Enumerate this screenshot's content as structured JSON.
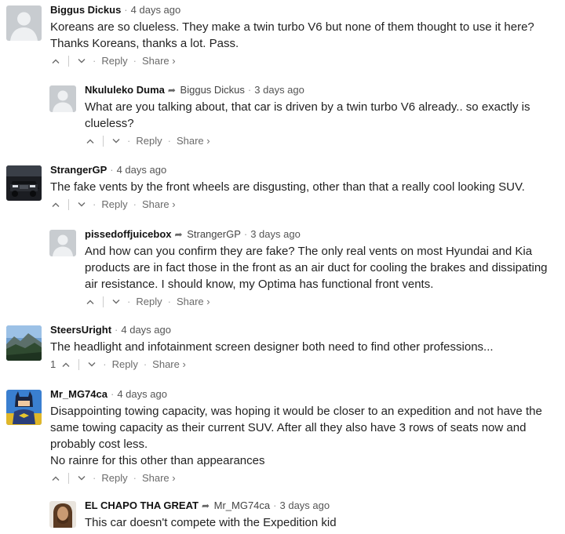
{
  "comments": [
    {
      "author": "Biggus Dickus",
      "time": "4 days ago",
      "lines": [
        "Koreans are so clueless. They make a twin turbo V6 but none of them thought to use it here? Thanks Koreans, thanks a lot. Pass."
      ],
      "reply_label": "Reply",
      "share_label": "Share ›"
    },
    {
      "author": "Nkululeko Duma",
      "parent": "Biggus Dickus",
      "time": "3 days ago",
      "lines": [
        "What are you talking about, that car is driven by a twin turbo V6 already.. so exactly is clueless?"
      ],
      "reply_label": "Reply",
      "share_label": "Share ›"
    },
    {
      "author": "StrangerGP",
      "time": "4 days ago",
      "lines": [
        "The fake vents by the front wheels are disgusting, other than that a really cool looking SUV."
      ],
      "reply_label": "Reply",
      "share_label": "Share ›"
    },
    {
      "author": "pissedoffjuicebox",
      "parent": "StrangerGP",
      "time": "3 days ago",
      "lines": [
        "And how can you confirm they are fake? The only real vents on most Hyundai and Kia products are in fact those in the front as an air duct for cooling the brakes and dissipating air resistance. I should know, my Optima has functional front vents."
      ],
      "reply_label": "Reply",
      "share_label": "Share ›"
    },
    {
      "author": "SteersUright",
      "time": "4 days ago",
      "lines": [
        "The headlight and infotainment screen designer both need to find other professions..."
      ],
      "upvotes": "1",
      "reply_label": "Reply",
      "share_label": "Share ›"
    },
    {
      "author": "Mr_MG74ca",
      "time": "4 days ago",
      "lines": [
        "Disappointing towing capacity, was hoping it would be closer to an expedition and not have the same towing capacity as their current SUV. After all they also have 3 rows of seats now and probably cost less.",
        "No rainre for this other than appearances"
      ],
      "reply_label": "Reply",
      "share_label": "Share ›"
    },
    {
      "author": "EL CHAPO THA GREAT",
      "parent": "Mr_MG74ca",
      "time": "3 days ago",
      "lines": [
        "This car doesn't compete with the Expedition kid"
      ]
    }
  ],
  "theme": {
    "text": "#222222",
    "muted": "#6b6b6b",
    "default_avatar_bg": "#c8ccd0"
  }
}
